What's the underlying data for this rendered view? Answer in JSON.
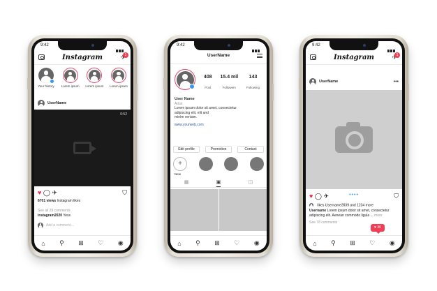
{
  "phone1": {
    "time": "9:42",
    "logo": "Instagram",
    "badge": "1",
    "stories": [
      {
        "label": "Your history"
      },
      {
        "label": "Lorem ipsum"
      },
      {
        "label": "Lorem ipsum"
      },
      {
        "label": "Lorem ipsum"
      }
    ],
    "post_user": "UserName",
    "video_time": "0:52",
    "views": "6701 views",
    "likes_suffix": "Instagram likes",
    "see_comments": "See all 29 comments",
    "comment_user": "instagram2020",
    "comment_text": "Yess",
    "add_comment": "Add a comment ..."
  },
  "phone2": {
    "time": "9:42",
    "username": "UserName",
    "stats": [
      {
        "value": "408",
        "label": "Post"
      },
      {
        "value": "15.4 mil",
        "label": "Followers"
      },
      {
        "value": "143",
        "label": "Following"
      }
    ],
    "name": "User Name",
    "role": "Artist",
    "bio_lines": [
      "Lorem ipsum dolor sit amet, consectetur",
      "adipiscing elit, elit and",
      "minim veniam."
    ],
    "link": "www.yourweb.com",
    "buttons": [
      "Edit profile",
      "Promotion",
      "Contact"
    ],
    "new_label": "New"
  },
  "phone3": {
    "time": "9:42",
    "logo": "Instagram",
    "badge": "1",
    "post_user": "UserName",
    "likes_line": "likes Username3939 and 1234 more",
    "caption_user": "Username",
    "caption_1": "Lorem ipsum dolor sit amet, consectetur",
    "caption_2": "adipiscing elit. Aenean commodo ligula ...",
    "caption_more": "more",
    "see_comments": "See 78 comments",
    "notif_count": "30"
  }
}
